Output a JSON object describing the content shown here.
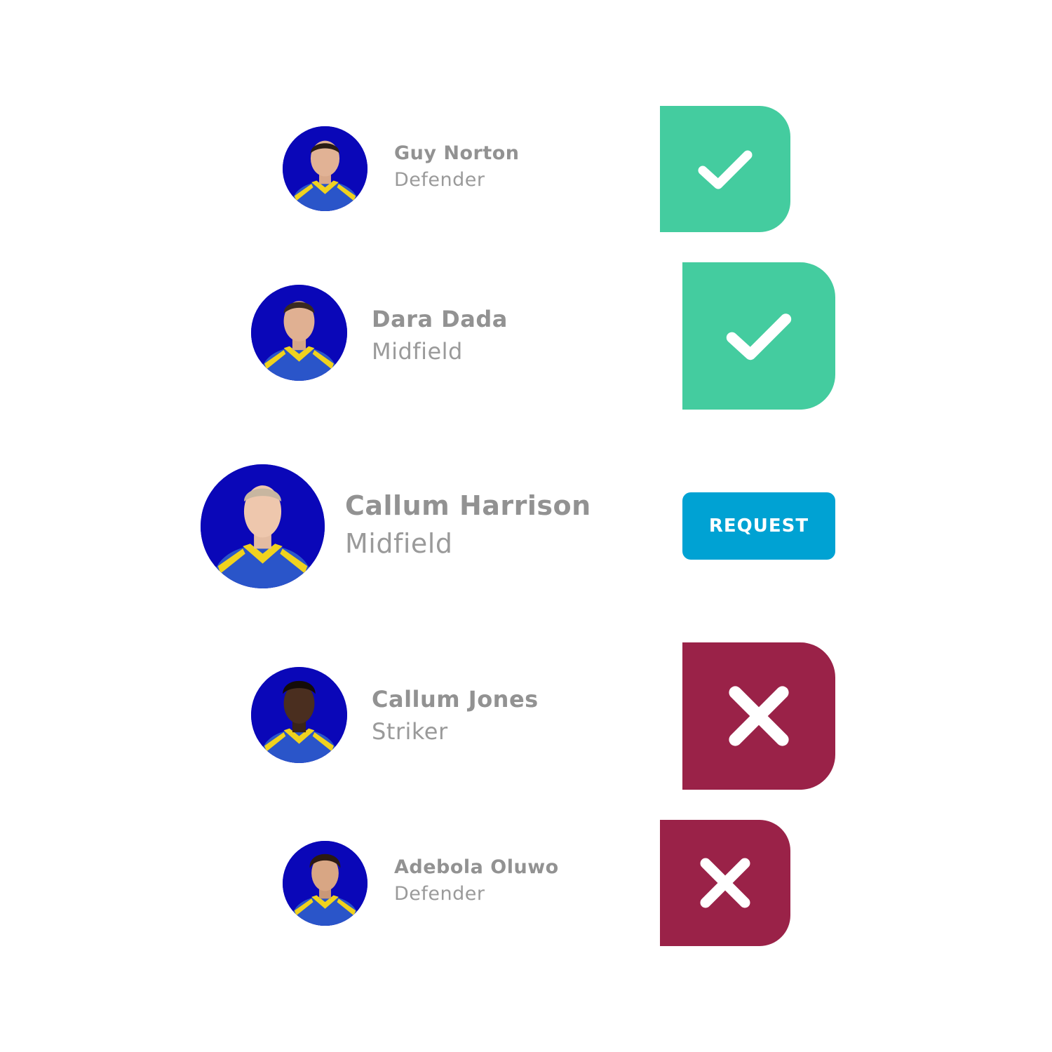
{
  "players": [
    {
      "name": "Guy Norton",
      "position": "Defender",
      "status": "accepted",
      "status_icon": "check-icon"
    },
    {
      "name": "Dara Dada",
      "position": "Midfield",
      "status": "accepted",
      "status_icon": "check-icon"
    },
    {
      "name": "Callum Harrison",
      "position": "Midfield",
      "status": "pending",
      "action_label": "REQUEST"
    },
    {
      "name": "Callum Jones",
      "position": "Striker",
      "status": "declined",
      "status_icon": "close-icon"
    },
    {
      "name": "Adebola Oluwo",
      "position": "Defender",
      "status": "declined",
      "status_icon": "close-icon"
    }
  ],
  "colors": {
    "accepted": "#44cc9f",
    "declined": "#9a2248",
    "request": "#00a2d3",
    "avatar_bg": "#0a07b8",
    "jersey": "#2a55c9",
    "jersey_collar": "#f0d21e",
    "text": "#929292"
  }
}
